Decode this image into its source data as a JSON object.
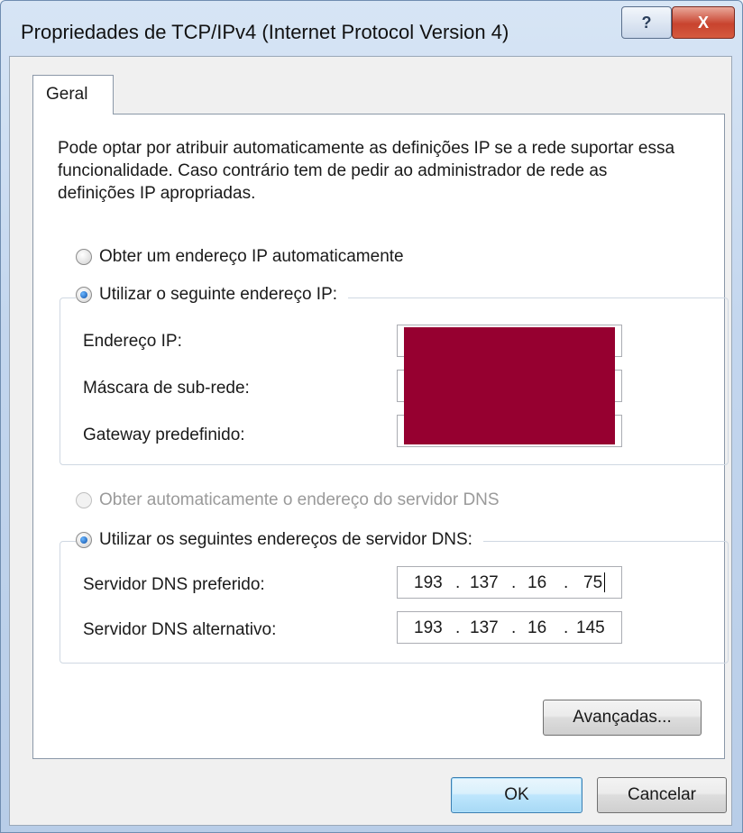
{
  "window": {
    "title": "Propriedades de TCP/IPv4 (Internet Protocol Version 4)",
    "help_glyph": "?",
    "close_glyph": "X"
  },
  "tabs": [
    {
      "label": "Geral",
      "selected": true
    }
  ],
  "description": "Pode optar por atribuir automaticamente as definições IP se a rede suportar essa funcionalidade. Caso contrário tem de pedir ao administrador de rede as definições IP apropriadas.",
  "ip": {
    "auto_label": "Obter um endereço IP automaticamente",
    "manual_label": "Utilizar o seguinte endereço IP:",
    "selected": "manual",
    "address_label": "Endereço IP:",
    "mask_label": "Máscara de sub-rede:",
    "gateway_label": "Gateway predefinido:"
  },
  "dns": {
    "auto_label": "Obter automaticamente o endereço do servidor DNS",
    "auto_disabled": true,
    "manual_label": "Utilizar os seguintes endereços de servidor DNS:",
    "selected": "manual",
    "preferred_label": "Servidor DNS preferido:",
    "alternate_label": "Servidor DNS alternativo:",
    "preferred": [
      "193",
      "137",
      "16",
      "75"
    ],
    "alternate": [
      "193",
      "137",
      "16",
      "145"
    ]
  },
  "buttons": {
    "advanced": "Avançadas...",
    "ok": "OK",
    "cancel": "Cancelar"
  },
  "colors": {
    "redaction": "#960030",
    "selected_radio": "#0b4fa8"
  }
}
